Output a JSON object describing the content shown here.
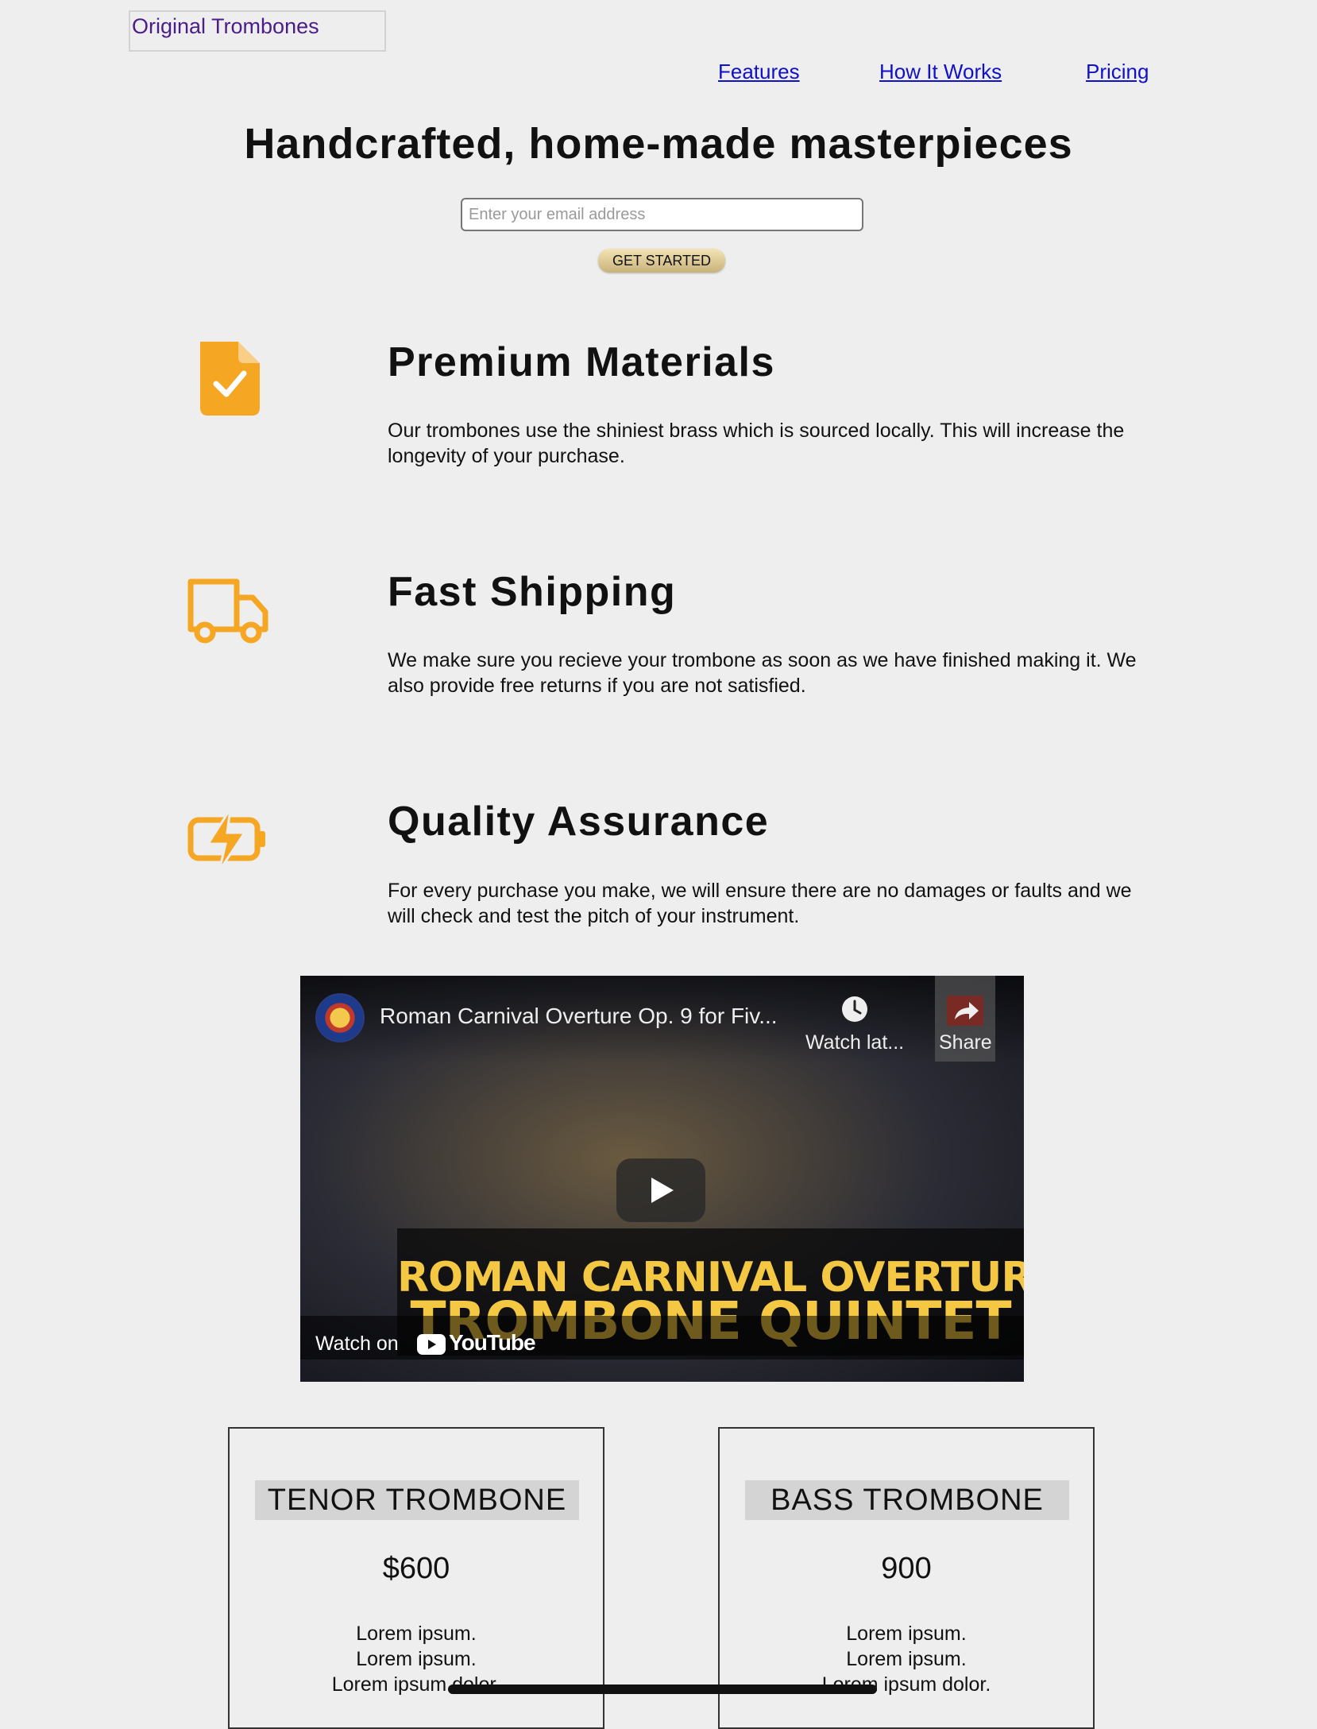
{
  "header": {
    "logo_text": "Original Trombones",
    "nav": [
      {
        "label": "Features"
      },
      {
        "label": "How It Works"
      },
      {
        "label": "Pricing"
      }
    ]
  },
  "hero": {
    "title": "Handcrafted, home-made masterpieces",
    "email_placeholder": "Enter your email address",
    "cta_label": "GET STARTED"
  },
  "colors": {
    "accent_icon": "#f5a623",
    "nav_link": "#1010cc",
    "logo_text": "#4b1d8a",
    "video_overlay_text": "#f4c842"
  },
  "features": [
    {
      "icon": "file-check-icon",
      "title": "Premium Materials",
      "text": "Our trombones use the shiniest brass which is sourced locally. This will increase the longevity of your purchase."
    },
    {
      "icon": "truck-icon",
      "title": "Fast Shipping",
      "text": "We make sure you recieve your trombone as soon as we have finished making it. We also provide free returns if you are not satisfied."
    },
    {
      "icon": "battery-charging-icon",
      "title": "Quality Assurance",
      "text": "For every purchase you make, we will ensure there are no damages or faults and we will check and test the pitch of your instrument."
    }
  ],
  "video": {
    "title": "Roman Carnival Overture Op. 9 for Fiv...",
    "watch_later_label": "Watch lat...",
    "share_label": "Share",
    "overlay_line1": "ROMAN CARNIVAL OVERTURE",
    "overlay_line2": "TROMBONE QUINTET",
    "watch_on_label": "Watch on",
    "youtube_label": "YouTube"
  },
  "pricing": [
    {
      "name": "TENOR TROMBONE",
      "price": "$600",
      "features": [
        "Lorem ipsum.",
        "Lorem ipsum.",
        "Lorem ipsum dolor."
      ]
    },
    {
      "name": "BASS TROMBONE",
      "price": "900",
      "features": [
        "Lorem ipsum.",
        "Lorem ipsum.",
        "Lorem ipsum dolor."
      ]
    }
  ]
}
